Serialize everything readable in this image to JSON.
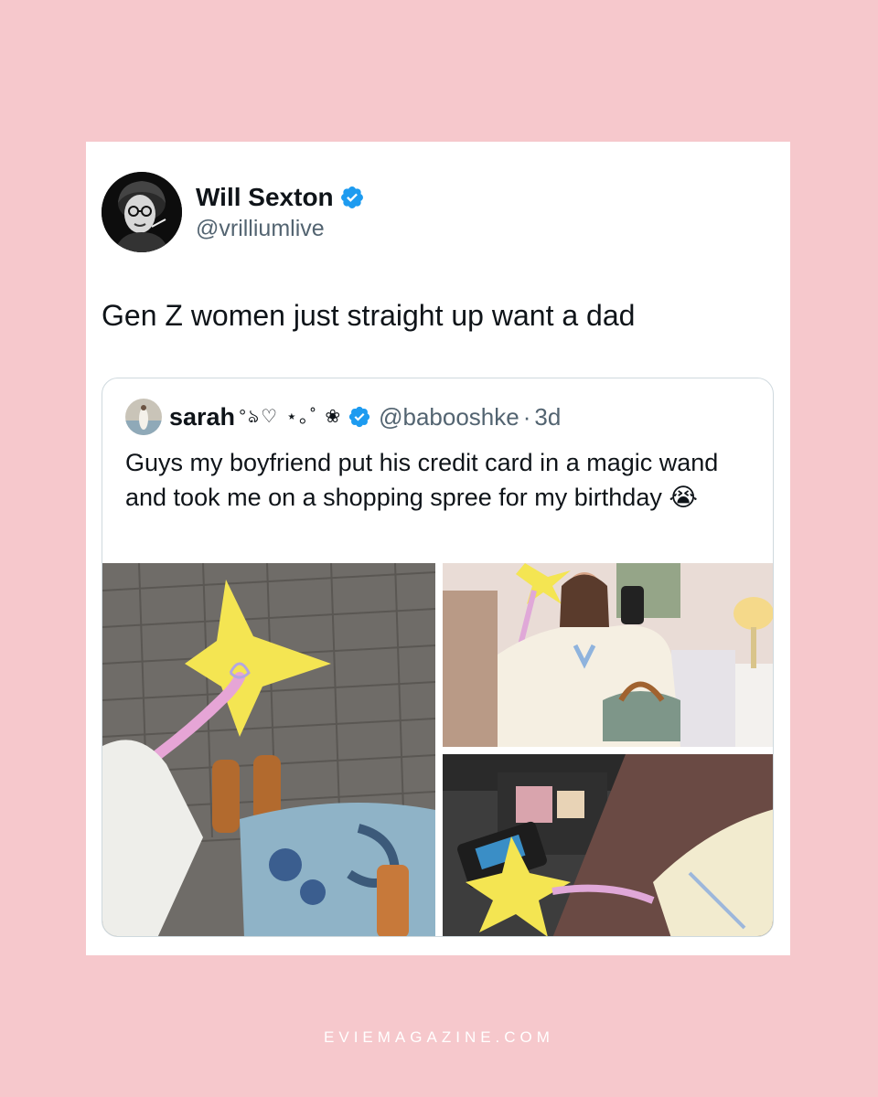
{
  "tweet": {
    "author_name": "Will Sexton",
    "author_handle": "@vrilliumlive",
    "text": "Gen Z women just straight up want a dad",
    "verified_color": "#1d9bf0"
  },
  "quoted_tweet": {
    "author_name": "sarah",
    "author_decoration": "°ঌ♡ ⋆｡˚ ❀",
    "author_handle": "@babooshke",
    "separator": "·",
    "timestamp": "3d",
    "text": "Guys my boyfriend put his credit card in a magic wand and took me on a shopping spree for my birthday 😭",
    "media": [
      {
        "icon": "star-wand-on-pavement-photo"
      },
      {
        "icon": "mirror-selfie-photo"
      },
      {
        "icon": "wand-at-card-reader-photo"
      }
    ]
  },
  "footer": {
    "text": "EVIEMAGAZINE.COM"
  },
  "colors": {
    "background": "#f6c8cc",
    "card": "#ffffff",
    "text_primary": "#0f1419",
    "text_secondary": "#536471"
  }
}
